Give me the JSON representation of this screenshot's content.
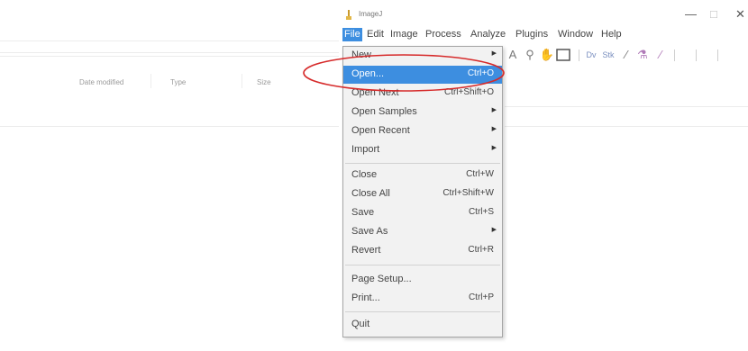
{
  "background_explorer": {
    "columns": [
      "Date modified",
      "Type",
      "Size"
    ]
  },
  "imagej": {
    "title": "ImageJ",
    "controls": {
      "minimize": "—",
      "maximize": "□",
      "close": "✕"
    },
    "menubar": [
      "File",
      "Edit",
      "Image",
      "Process",
      "Analyze",
      "Plugins",
      "Window",
      "Help"
    ],
    "active_menu": "File",
    "toolbar_icons": [
      "text-tool-icon",
      "magnifier-icon",
      "hand-icon",
      "rectangle-icon",
      "dropper-icon",
      "line-icon",
      "brush-icon",
      "flood-fill-icon",
      "wand-icon"
    ]
  },
  "file_menu": {
    "items": [
      {
        "label": "New",
        "shortcut": "",
        "submenu": true
      },
      {
        "label": "Open...",
        "shortcut": "Ctrl+O",
        "submenu": false,
        "highlighted": true
      },
      {
        "label": "Open Next",
        "shortcut": "Ctrl+Shift+O",
        "submenu": false
      },
      {
        "label": "Open Samples",
        "shortcut": "",
        "submenu": true
      },
      {
        "label": "Open Recent",
        "shortcut": "",
        "submenu": true
      },
      {
        "label": "Import",
        "shortcut": "",
        "submenu": true
      },
      {
        "label": "Close",
        "shortcut": "Ctrl+W",
        "submenu": false
      },
      {
        "label": "Close All",
        "shortcut": "Ctrl+Shift+W",
        "submenu": false
      },
      {
        "label": "Save",
        "shortcut": "Ctrl+S",
        "submenu": false
      },
      {
        "label": "Save As",
        "shortcut": "",
        "submenu": true
      },
      {
        "label": "Revert",
        "shortcut": "Ctrl+R",
        "submenu": false
      },
      {
        "label": "Page Setup...",
        "shortcut": "",
        "submenu": false
      },
      {
        "label": "Print...",
        "shortcut": "Ctrl+P",
        "submenu": false
      },
      {
        "label": "Quit",
        "shortcut": "",
        "submenu": false
      }
    ]
  },
  "annotation": {
    "color": "#d62a2a"
  },
  "colors": {
    "highlight": "#3d8ee0",
    "menu_bg": "#f2f2f2"
  }
}
